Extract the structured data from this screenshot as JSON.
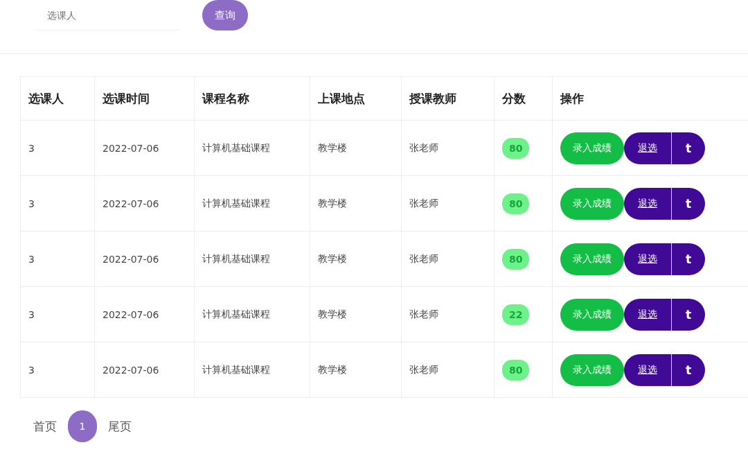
{
  "search": {
    "placeholder": "选课人",
    "button": "查询"
  },
  "table": {
    "columns": [
      "选课人",
      "选课时间",
      "课程名称",
      "上课地点",
      "授课教师",
      "分数",
      "操作"
    ],
    "rows": [
      {
        "student": "3",
        "time": "2022-07-06",
        "course": "计算机基础课程",
        "place": "教学楼",
        "teacher": "张老师",
        "score": "80",
        "actions": [
          "录入成绩",
          "退选",
          "t"
        ]
      },
      {
        "student": "3",
        "time": "2022-07-06",
        "course": "计算机基础课程",
        "place": "教学楼",
        "teacher": "张老师",
        "score": "80",
        "actions": [
          "录入成绩",
          "退选",
          "t"
        ]
      },
      {
        "student": "3",
        "time": "2022-07-06",
        "course": "计算机基础课程",
        "place": "教学楼",
        "teacher": "张老师",
        "score": "80",
        "actions": [
          "录入成绩",
          "退选",
          "t"
        ]
      },
      {
        "student": "3",
        "time": "2022-07-06",
        "course": "计算机基础课程",
        "place": "教学楼",
        "teacher": "张老师",
        "score": "22",
        "actions": [
          "录入成绩",
          "退选",
          "t"
        ]
      },
      {
        "student": "3",
        "time": "2022-07-06",
        "course": "计算机基础课程",
        "place": "教学楼",
        "teacher": "张老师",
        "score": "80",
        "actions": [
          "录入成绩",
          "退选",
          "t"
        ]
      }
    ]
  },
  "pagination": {
    "first": "首页",
    "pages": [
      {
        "label": "1",
        "selected": true
      }
    ],
    "last": "尾页"
  }
}
